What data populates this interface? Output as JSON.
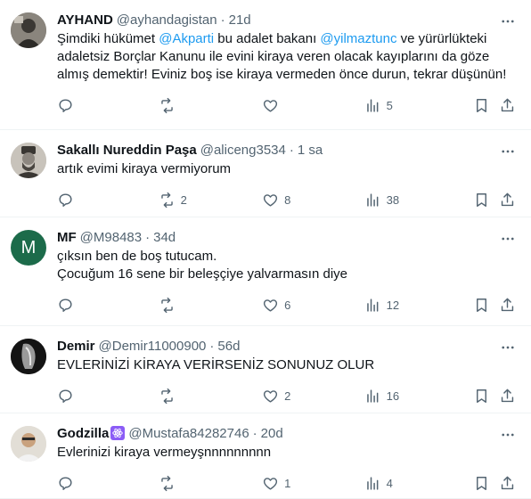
{
  "tweets": [
    {
      "name": "AYHAND",
      "handle": "@ayhandagistan",
      "sep": "·",
      "time": "21d",
      "text_parts": [
        "Şimdiki hükümet ",
        "@Akparti",
        " bu adalet bakanı ",
        "@yilmaztunc",
        " ve yürürlükteki adaletsiz Borçlar Kanunu ile evini kiraya veren olacak kayıplarını da göze almış demektir! Eviniz boş ise kiraya vermeden önce durun, tekrar düşünün!"
      ],
      "replies": "",
      "retweets": "",
      "likes": "",
      "views": "5"
    },
    {
      "name": "Sakallı Nureddin Paşa",
      "handle": "@aliceng3534",
      "sep": "·",
      "time": "1 sa",
      "text": "artık evimi kiraya vermiyorum",
      "replies": "",
      "retweets": "2",
      "likes": "8",
      "views": "38"
    },
    {
      "name": "MF",
      "handle": "@M98483",
      "sep": "·",
      "time": "34d",
      "avatar_letter": "M",
      "text": "çıksın ben de boş tutucam.\nÇocuğum  16 sene bir beleşçiye yalvarmasın diye",
      "replies": "",
      "retweets": "",
      "likes": "6",
      "views": "12"
    },
    {
      "name": "Demir",
      "handle": "@Demir11000900",
      "sep": "·",
      "time": "56d",
      "text": "EVLERİNİZİ KİRAYA VERİRSENİZ SONUNUZ OLUR",
      "replies": "",
      "retweets": "",
      "likes": "2",
      "views": "16"
    },
    {
      "name": "Godzilla",
      "handle": "@Mustafa84282746",
      "sep": "·",
      "time": "20d",
      "text": "Evlerinizi kiraya vermeyşnnnnnnnnn",
      "replies": "",
      "retweets": "",
      "likes": "1",
      "views": "4"
    }
  ],
  "colors": {
    "accent": "#1d9bf0",
    "text": "#0f1419",
    "muted": "#536471",
    "divider": "#eff3f4",
    "mf_avatar": "#1c6b4a",
    "badge": "#8b5cf6"
  },
  "icons": [
    "more-icon",
    "reply-icon",
    "retweet-icon",
    "like-icon",
    "views-icon",
    "bookmark-icon",
    "share-icon",
    "atom-badge-icon"
  ]
}
